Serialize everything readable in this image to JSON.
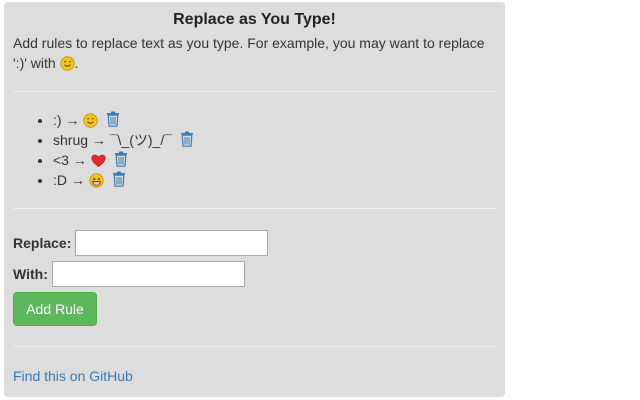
{
  "title": "Replace as You Type!",
  "intro": {
    "text": "Add rules to replace text as you type. For example, you may want to replace ':)' with",
    "end": ".",
    "emoji": "smiling-face-icon"
  },
  "rules": [
    {
      "from": ":)",
      "arrow": "→",
      "to_emoji": "smiling-face-icon",
      "to_text": ""
    },
    {
      "from": "shrug",
      "arrow": "→",
      "to_emoji": "",
      "to_text": "¯\\_(ツ)_/¯"
    },
    {
      "from": "<3",
      "arrow": "→",
      "to_emoji": "red-heart-icon",
      "to_text": ""
    },
    {
      "from": ":D",
      "arrow": "→",
      "to_emoji": "grinning-face-icon",
      "to_text": ""
    }
  ],
  "form": {
    "replace_label": "Replace:",
    "replace_value": "",
    "with_label": "With:",
    "with_value": "",
    "add_button": "Add Rule"
  },
  "footer": {
    "link_text": "Find this on GitHub"
  },
  "colors": {
    "panel": "#dddddd",
    "button": "#5cb85c",
    "link": "#337ab7",
    "trash": "#337ab7",
    "heart": "#e0282e",
    "emoji": "#f5c518"
  }
}
